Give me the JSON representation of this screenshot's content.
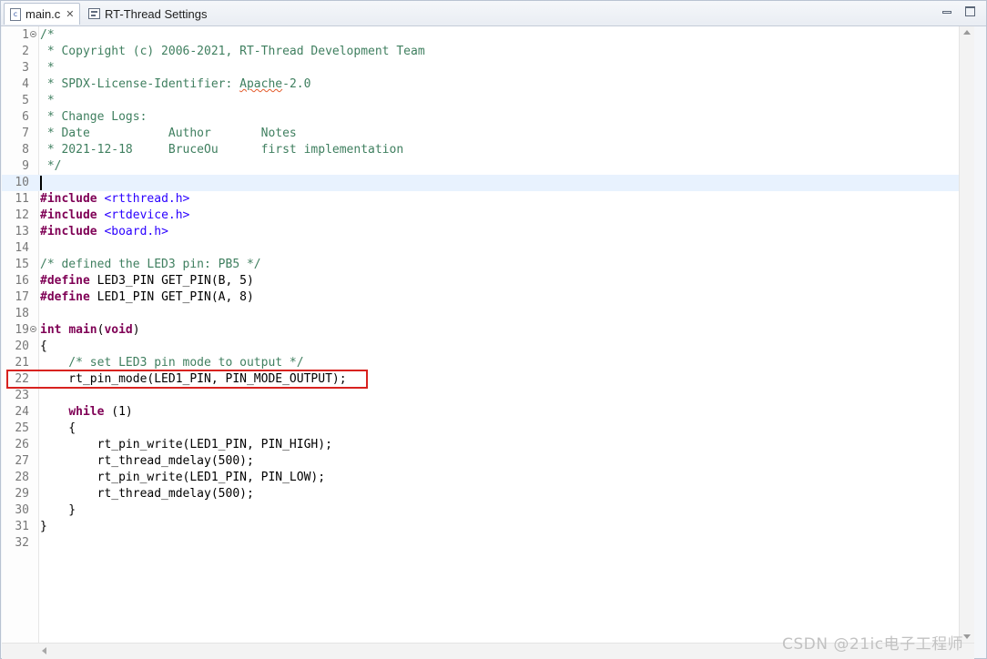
{
  "tabs": [
    {
      "label": "main.c",
      "active": true,
      "icon": "c-file-icon",
      "closable": true
    },
    {
      "label": "RT-Thread Settings",
      "active": false,
      "icon": "settings-icon"
    }
  ],
  "editor": {
    "current_line": 10,
    "highlighted_line": 22,
    "lines": [
      {
        "n": "1",
        "fold": true,
        "tokens": [
          [
            "comment",
            "/*"
          ]
        ]
      },
      {
        "n": "2",
        "tokens": [
          [
            "comment",
            " * Copyright (c) 2006-2021, RT-Thread Development Team"
          ]
        ]
      },
      {
        "n": "3",
        "tokens": [
          [
            "comment",
            " *"
          ]
        ]
      },
      {
        "n": "4",
        "tokens": [
          [
            "comment",
            " * SPDX-License-Identifier: "
          ],
          [
            "comment-squiggle",
            "Apache"
          ],
          [
            "comment",
            "-2.0"
          ]
        ]
      },
      {
        "n": "5",
        "tokens": [
          [
            "comment",
            " *"
          ]
        ]
      },
      {
        "n": "6",
        "tokens": [
          [
            "comment",
            " * Change Logs:"
          ]
        ]
      },
      {
        "n": "7",
        "tokens": [
          [
            "comment",
            " * Date           Author       Notes"
          ]
        ]
      },
      {
        "n": "8",
        "tokens": [
          [
            "comment",
            " * 2021-12-18     BruceOu      first implementation"
          ]
        ]
      },
      {
        "n": "9",
        "tokens": [
          [
            "comment",
            " */"
          ]
        ]
      },
      {
        "n": "10",
        "tokens": []
      },
      {
        "n": "11",
        "tokens": [
          [
            "kw",
            "#include"
          ],
          [
            "plain",
            " "
          ],
          [
            "str",
            "<rtthread.h>"
          ]
        ]
      },
      {
        "n": "12",
        "tokens": [
          [
            "kw",
            "#include"
          ],
          [
            "plain",
            " "
          ],
          [
            "str",
            "<rtdevice.h>"
          ]
        ]
      },
      {
        "n": "13",
        "tokens": [
          [
            "kw",
            "#include"
          ],
          [
            "plain",
            " "
          ],
          [
            "str",
            "<board.h>"
          ]
        ]
      },
      {
        "n": "14",
        "tokens": []
      },
      {
        "n": "15",
        "tokens": [
          [
            "comment",
            "/* defined the LED3 pin: PB5 */"
          ]
        ]
      },
      {
        "n": "16",
        "tokens": [
          [
            "kw",
            "#define"
          ],
          [
            "plain",
            " LED3_PIN GET_PIN(B, 5)"
          ]
        ]
      },
      {
        "n": "17",
        "tokens": [
          [
            "kw",
            "#define"
          ],
          [
            "plain",
            " LED1_PIN GET_PIN(A, 8)"
          ]
        ]
      },
      {
        "n": "18",
        "tokens": []
      },
      {
        "n": "19",
        "fold": true,
        "tokens": [
          [
            "kw",
            "int"
          ],
          [
            "plain",
            " "
          ],
          [
            "kw",
            "main"
          ],
          [
            "plain",
            "("
          ],
          [
            "kw",
            "void"
          ],
          [
            "plain",
            ")"
          ]
        ]
      },
      {
        "n": "20",
        "tokens": [
          [
            "plain",
            "{"
          ]
        ]
      },
      {
        "n": "21",
        "tokens": [
          [
            "comment",
            "    /* set LED3 pin mode to output */"
          ]
        ]
      },
      {
        "n": "22",
        "tokens": [
          [
            "plain",
            "    rt_pin_mode(LED1_PIN, PIN_MODE_OUTPUT);"
          ]
        ]
      },
      {
        "n": "23",
        "tokens": []
      },
      {
        "n": "24",
        "tokens": [
          [
            "plain",
            "    "
          ],
          [
            "kw",
            "while"
          ],
          [
            "plain",
            " (1)"
          ]
        ]
      },
      {
        "n": "25",
        "tokens": [
          [
            "plain",
            "    {"
          ]
        ]
      },
      {
        "n": "26",
        "tokens": [
          [
            "plain",
            "        rt_pin_write(LED1_PIN, PIN_HIGH);"
          ]
        ]
      },
      {
        "n": "27",
        "tokens": [
          [
            "plain",
            "        rt_thread_mdelay(500);"
          ]
        ]
      },
      {
        "n": "28",
        "tokens": [
          [
            "plain",
            "        rt_pin_write(LED1_PIN, PIN_LOW);"
          ]
        ]
      },
      {
        "n": "29",
        "tokens": [
          [
            "plain",
            "        rt_thread_mdelay(500);"
          ]
        ]
      },
      {
        "n": "30",
        "tokens": [
          [
            "plain",
            "    }"
          ]
        ]
      },
      {
        "n": "31",
        "tokens": [
          [
            "plain",
            "}"
          ]
        ]
      },
      {
        "n": "32",
        "tokens": []
      }
    ]
  },
  "colors": {
    "comment": "#3f7f5f",
    "keyword": "#7f0055",
    "string": "#2a00ff",
    "current_line_bg": "#e8f2fe",
    "highlight_box": "#d8221f"
  },
  "watermark": "CSDN @21ic电子工程师"
}
